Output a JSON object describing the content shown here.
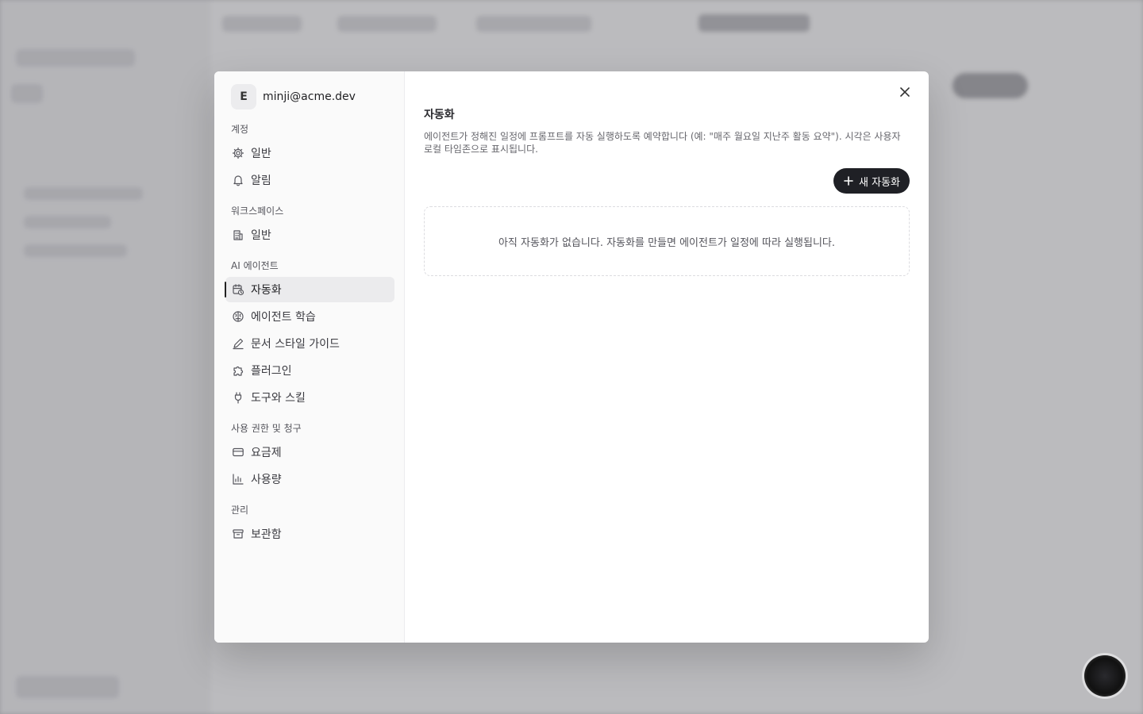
{
  "user": {
    "initial": "E",
    "email": "minji@acme.dev"
  },
  "sidebar": {
    "sections": [
      {
        "title": "계정",
        "items": [
          {
            "label": "일반",
            "icon": "gear-icon"
          },
          {
            "label": "알림",
            "icon": "bell-icon"
          }
        ]
      },
      {
        "title": "워크스페이스",
        "items": [
          {
            "label": "일반",
            "icon": "building-icon"
          }
        ]
      },
      {
        "title": "AI 에이전트",
        "items": [
          {
            "label": "자동화",
            "icon": "calendar-clock-icon",
            "active": true
          },
          {
            "label": "에이전트 학습",
            "icon": "brain-icon"
          },
          {
            "label": "문서 스타일 가이드",
            "icon": "pen-icon"
          },
          {
            "label": "플러그인",
            "icon": "puzzle-icon"
          },
          {
            "label": "도구와 스킬",
            "icon": "plug-icon"
          }
        ]
      },
      {
        "title": "사용 권한 및 청구",
        "items": [
          {
            "label": "요금제",
            "icon": "credit-card-icon"
          },
          {
            "label": "사용량",
            "icon": "bar-chart-icon"
          }
        ]
      },
      {
        "title": "관리",
        "items": [
          {
            "label": "보관함",
            "icon": "archive-icon"
          }
        ]
      }
    ]
  },
  "main": {
    "title": "자동화",
    "description": "에이전트가 정해진 일정에 프롬프트를 자동 실행하도록 예약합니다 (예: \"매주 월요일 지난주 활동 요약\"). 시각은 사용자 로컬 타임존으로 표시됩니다.",
    "new_button": "새 자동화",
    "empty_text": "아직 자동화가 없습니다. 자동화를 만들면 에이전트가 일정에 따라 실행됩니다."
  }
}
